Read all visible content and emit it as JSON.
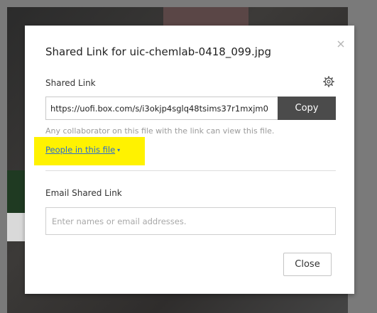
{
  "dialog": {
    "title": "Shared Link for uic-chemlab-0418_099.jpg"
  },
  "shared_link": {
    "label": "Shared Link",
    "url": "https://uofi.box.com/s/i3okjp4sglq48tsims37r1mxjm0",
    "copy_label": "Copy",
    "helper": "Any collaborator on this file with the link can view this file.",
    "access_label": "People in this file",
    "access_caret": "▾"
  },
  "email": {
    "label": "Email Shared Link",
    "placeholder": "Enter names or email addresses."
  },
  "footer": {
    "close_label": "Close"
  },
  "colors": {
    "highlight": "#fff200",
    "link": "#2a6bd1",
    "copy_button": "#4b4b4b"
  }
}
